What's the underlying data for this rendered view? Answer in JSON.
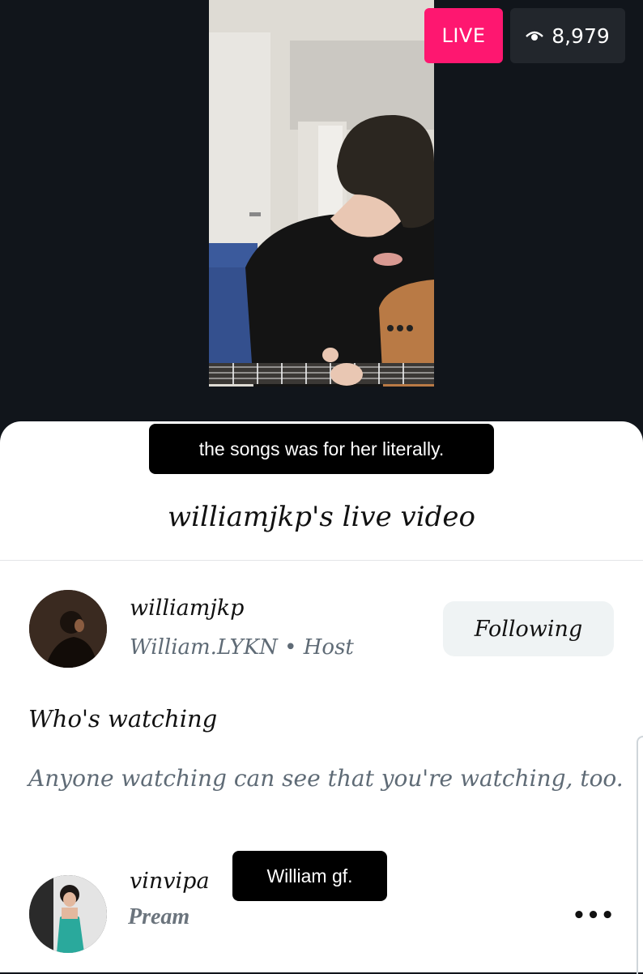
{
  "stream": {
    "live_label": "LIVE",
    "viewer_count": "8,979",
    "caption": "the songs was for  her literally."
  },
  "sheet": {
    "title": "williamjkp's live video"
  },
  "host": {
    "username": "williamjkp",
    "subtitle": "William.LYKN • Host",
    "follow_label": "Following"
  },
  "watching": {
    "heading": "Who's watching",
    "description": "Anyone watching can see that you're watching, too."
  },
  "viewers": [
    {
      "username": "vinvipa",
      "subtitle": "Pream",
      "tag": "William gf.",
      "more_label": "•••"
    }
  ],
  "icons": {
    "viewer_count": "eye-icon",
    "more": "more-options-icon"
  },
  "colors": {
    "live": "#fe1770",
    "dark_bg": "#11151b",
    "muted_text": "#5f6b76",
    "button_bg": "#eff3f4"
  }
}
